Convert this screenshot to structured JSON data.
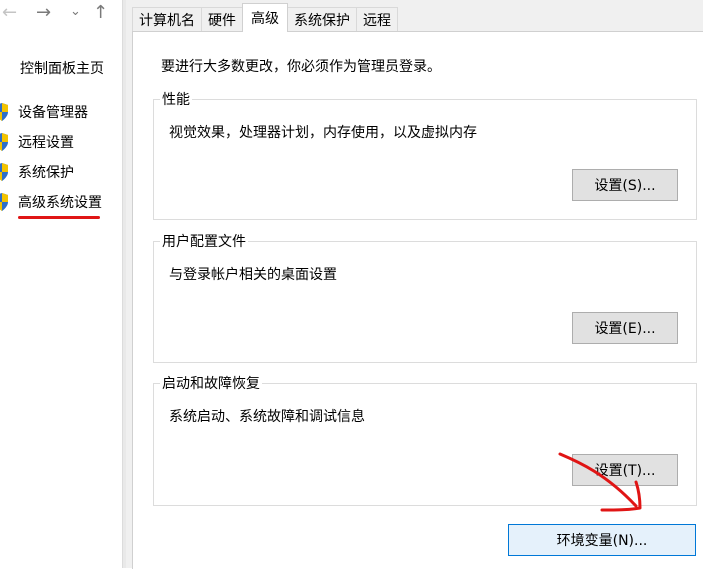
{
  "nav": {
    "back": "←",
    "forward": "→",
    "recent": "⌄",
    "up": "↑"
  },
  "sidebar": {
    "home": "控制面板主页",
    "items": [
      {
        "label": "设备管理器",
        "icon": "shield-icon"
      },
      {
        "label": "远程设置",
        "icon": "shield-icon"
      },
      {
        "label": "系统保护",
        "icon": "shield-icon"
      },
      {
        "label": "高级系统设置",
        "icon": "shield-icon",
        "highlighted": true
      }
    ]
  },
  "tabs": [
    {
      "label": "计算机名"
    },
    {
      "label": "硬件"
    },
    {
      "label": "高级",
      "active": true
    },
    {
      "label": "系统保护"
    },
    {
      "label": "远程"
    }
  ],
  "advanced": {
    "intro": "要进行大多数更改，你必须作为管理员登录。",
    "groups": [
      {
        "title": "性能",
        "description": "视觉效果，处理器计划，内存使用，以及虚拟内存",
        "button": "设置(S)..."
      },
      {
        "title": "用户配置文件",
        "description": "与登录帐户相关的桌面设置",
        "button": "设置(E)..."
      },
      {
        "title": "启动和故障恢复",
        "description": "系统启动、系统故障和调试信息",
        "button": "设置(T)..."
      }
    ],
    "env_button": "环境变量(N)..."
  },
  "colors": {
    "accent": "#0078d7",
    "annotation": "#e01515",
    "dialog_bg": "#f0f0f0"
  }
}
